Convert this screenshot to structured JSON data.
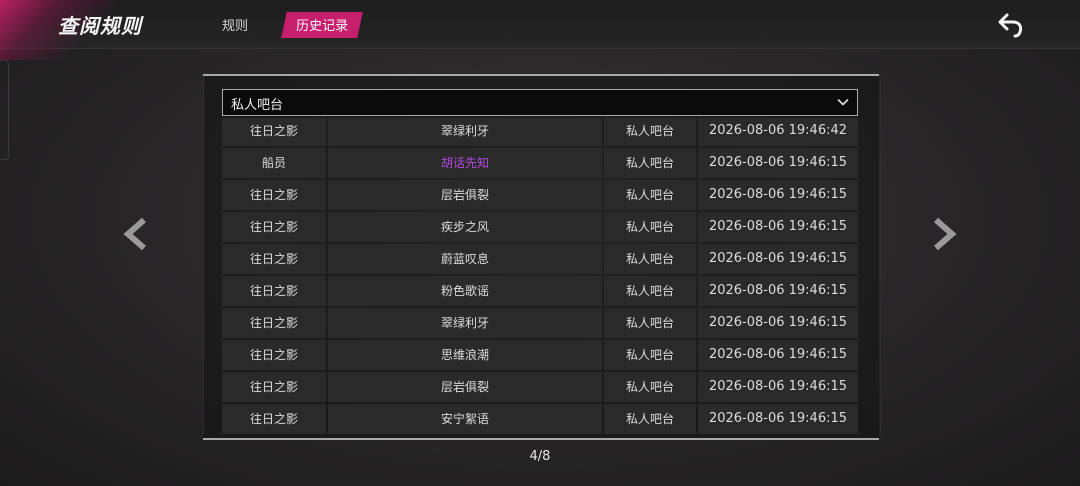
{
  "header": {
    "title": "查阅规则",
    "tabs": [
      {
        "label": "规则",
        "active": false
      },
      {
        "label": "历史记录",
        "active": true
      }
    ],
    "back_icon": "back-arrow-icon",
    "accent_color": "#c81e6e"
  },
  "filter": {
    "selected": "私人吧台",
    "icon": "chevron-down-icon"
  },
  "records": [
    {
      "role": "往日之影",
      "card": "翠绿利牙",
      "location": "私人吧台",
      "time": "2026-08-06 19:46:42",
      "highlight": false
    },
    {
      "role": "船员",
      "card": "胡话先知",
      "location": "私人吧台",
      "time": "2026-08-06 19:46:15",
      "highlight": true
    },
    {
      "role": "往日之影",
      "card": "层岩俱裂",
      "location": "私人吧台",
      "time": "2026-08-06 19:46:15",
      "highlight": false
    },
    {
      "role": "往日之影",
      "card": "疾步之风",
      "location": "私人吧台",
      "time": "2026-08-06 19:46:15",
      "highlight": false
    },
    {
      "role": "往日之影",
      "card": "蔚蓝叹息",
      "location": "私人吧台",
      "time": "2026-08-06 19:46:15",
      "highlight": false
    },
    {
      "role": "往日之影",
      "card": "粉色歌谣",
      "location": "私人吧台",
      "time": "2026-08-06 19:46:15",
      "highlight": false
    },
    {
      "role": "往日之影",
      "card": "翠绿利牙",
      "location": "私人吧台",
      "time": "2026-08-06 19:46:15",
      "highlight": false
    },
    {
      "role": "往日之影",
      "card": "思维浪潮",
      "location": "私人吧台",
      "time": "2026-08-06 19:46:15",
      "highlight": false
    },
    {
      "role": "往日之影",
      "card": "层岩俱裂",
      "location": "私人吧台",
      "time": "2026-08-06 19:46:15",
      "highlight": false
    },
    {
      "role": "往日之影",
      "card": "安宁絮语",
      "location": "私人吧台",
      "time": "2026-08-06 19:46:15",
      "highlight": false
    }
  ],
  "highlight_color": "#b24adf",
  "pagination": {
    "label": "4/8",
    "prev_icon": "chevron-left-icon",
    "next_icon": "chevron-right-icon"
  }
}
